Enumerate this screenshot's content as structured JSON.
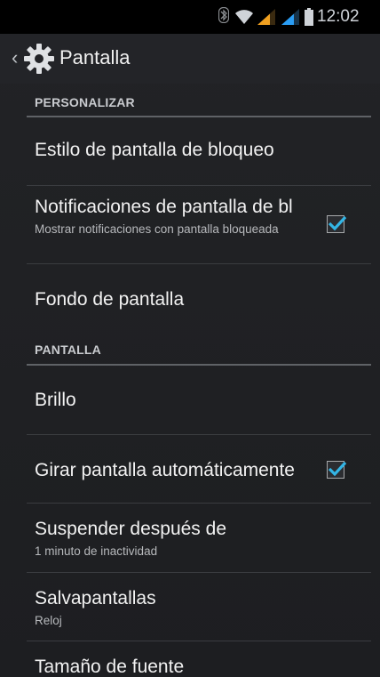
{
  "status_bar": {
    "time": "12:02",
    "icons": [
      "bluetooth-icon",
      "wifi-icon",
      "signal-sim1-icon",
      "signal-sim2-icon",
      "battery-icon"
    ],
    "signal_color": "#f0a020",
    "signal2_color": "#2a9df4"
  },
  "action_bar": {
    "title": "Pantalla",
    "icon": "settings-gear-icon"
  },
  "sections": [
    {
      "header": "PERSONALIZAR",
      "items": [
        {
          "title": "Estilo de pantalla de bloqueo",
          "summary": ""
        },
        {
          "title": "Notificaciones de pantalla de bl",
          "summary": "Mostrar notificaciones con pantalla bloqueada",
          "checked": true
        },
        {
          "title": "Fondo de pantalla",
          "summary": ""
        }
      ]
    },
    {
      "header": "PANTALLA",
      "items": [
        {
          "title": "Brillo",
          "summary": ""
        },
        {
          "title": "Girar pantalla automáticamente",
          "summary": "",
          "checked": true
        },
        {
          "title": "Suspender después de",
          "summary": "1 minuto de inactividad"
        },
        {
          "title": "Salvapantallas",
          "summary": "Reloj"
        },
        {
          "title": "Tamaño de fuente",
          "summary": ""
        }
      ]
    }
  ],
  "colors": {
    "accent": "#33b5e5",
    "background": "#1f2023",
    "divider": "#3a3c40"
  }
}
